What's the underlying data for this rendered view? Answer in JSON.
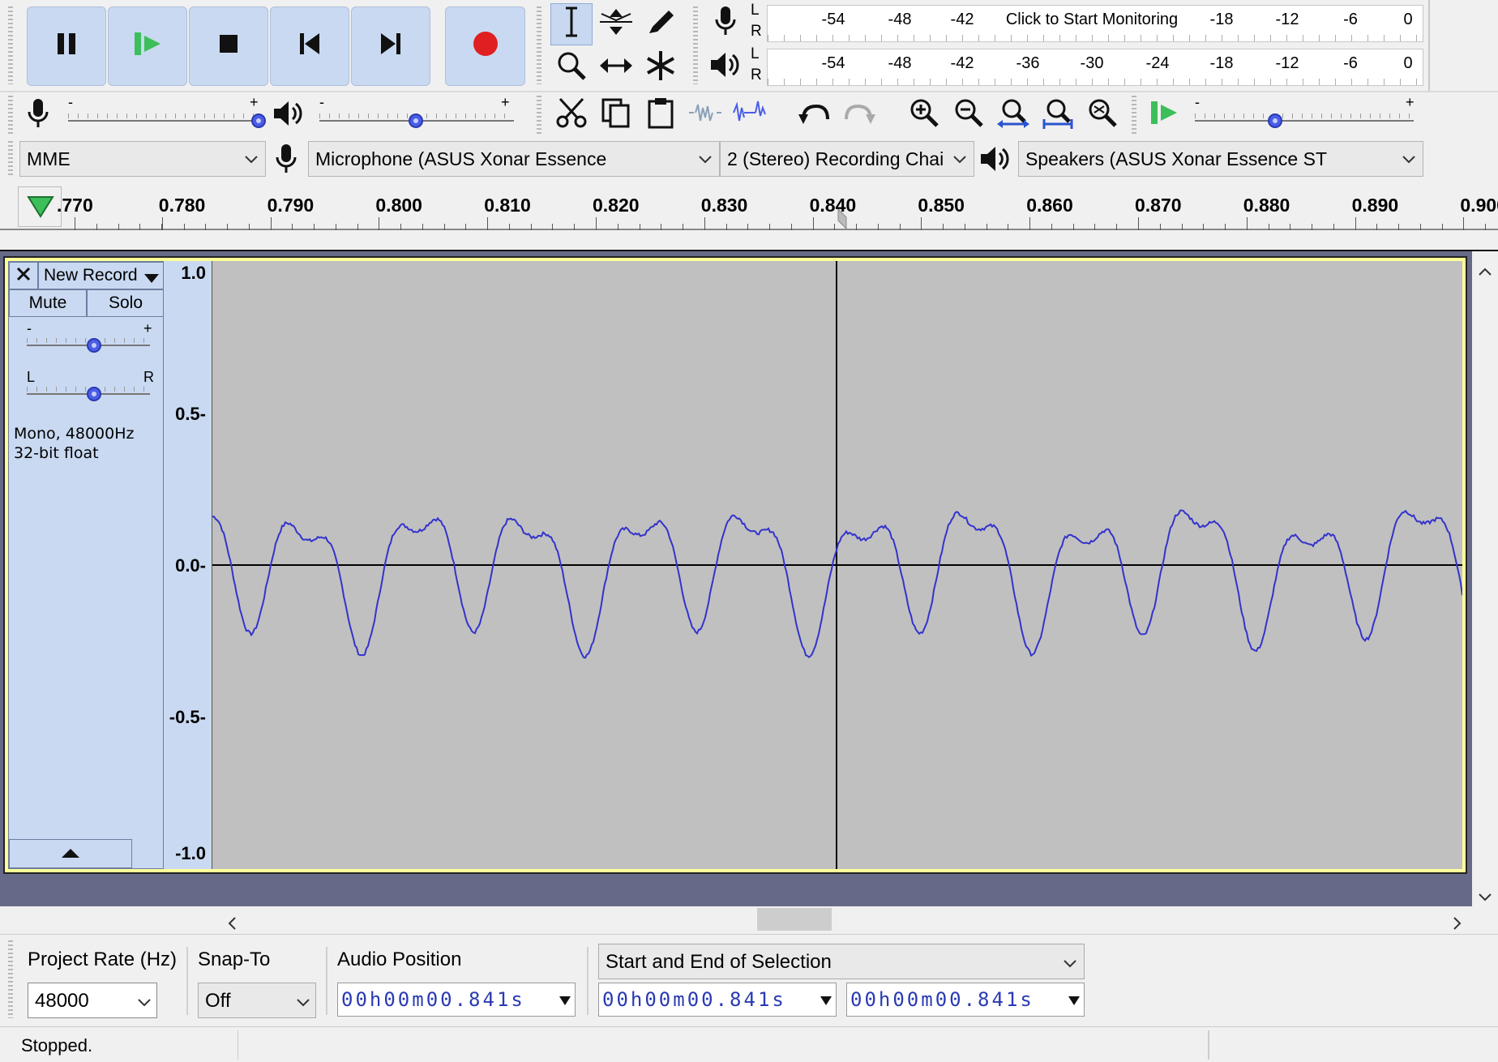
{
  "transport": {
    "pause": "pause-icon",
    "play": "play-icon",
    "stop": "stop-icon",
    "skip_start": "skip-start-icon",
    "skip_end": "skip-end-icon",
    "record": "record-icon"
  },
  "meters": {
    "record_L": "L",
    "record_R": "R",
    "play_L": "L",
    "play_R": "R",
    "record_ticks": [
      "-54",
      "-48",
      "-42",
      "Click to Start Monitoring",
      "-18",
      "-12",
      "-6",
      "0"
    ],
    "play_ticks": [
      "-54",
      "-48",
      "-42",
      "-36",
      "-30",
      "-24",
      "-18",
      "-12",
      "-6",
      "0"
    ]
  },
  "mixer": {
    "minus": "-",
    "plus": "+"
  },
  "device": {
    "host": "MME",
    "mic": "Microphone (ASUS Xonar Essence",
    "channels": "2 (Stereo) Recording Chai",
    "speakers": "Speakers (ASUS Xonar Essence ST"
  },
  "ruler": {
    "labels": [
      ".770",
      "0.780",
      "0.790",
      "0.800",
      "0.810",
      "0.820",
      "0.830",
      "0.840",
      "0.850",
      "0.860",
      "0.870",
      "0.880",
      "0.890",
      "0.900"
    ]
  },
  "track": {
    "name": "New Record",
    "mute": "Mute",
    "solo": "Solo",
    "gain_minus": "-",
    "gain_plus": "+",
    "pan_L": "L",
    "pan_R": "R",
    "info_line1": "Mono, 48000Hz",
    "info_line2": "32-bit float",
    "scale": [
      "1.0",
      "0.5-",
      "0.0-",
      "-0.5-",
      "-1.0"
    ]
  },
  "selection_bar": {
    "project_rate_label": "Project Rate (Hz)",
    "project_rate": "48000",
    "snap_label": "Snap-To",
    "snap_value": "Off",
    "audio_position_label": "Audio Position",
    "audio_position": "00h00m00.841s",
    "selection_mode": "Start and End of Selection",
    "sel_start": "00h00m00.841s",
    "sel_end": "00h00m00.841s"
  },
  "status": {
    "text": "Stopped."
  },
  "colors": {
    "waveform": "#3333cc",
    "track_bg": "#c0c0c0",
    "track_panel": "#c9d9f1",
    "focus_border": "#ffff99",
    "record_red": "#e02020",
    "play_green": "#3cbf5a"
  }
}
